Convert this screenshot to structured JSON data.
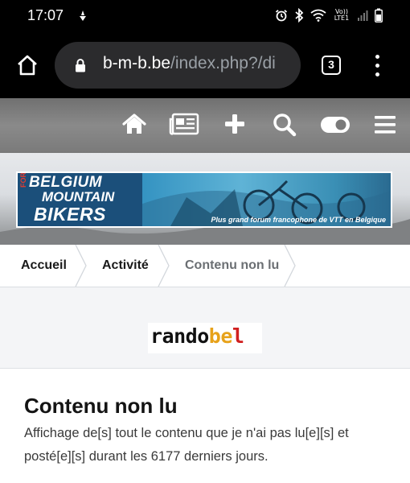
{
  "status_bar": {
    "time": "17:07",
    "volte_label": "Vo)) LTE1",
    "icons": [
      "alarm-icon",
      "bluetooth-icon",
      "wifi-icon",
      "signal-icon",
      "battery-icon"
    ]
  },
  "browser": {
    "url_domain": "b-m-b.be",
    "url_path": "/index.php?/di",
    "tab_count": "3",
    "icons": [
      "home-icon",
      "lock-icon",
      "overflow-menu-icon"
    ]
  },
  "forum_nav": {
    "icons": [
      "home-icon",
      "news-icon",
      "plus-icon",
      "search-icon",
      "theme-toggle-icon",
      "hamburger-menu-icon"
    ]
  },
  "banner": {
    "logo_forum": "FORUM",
    "logo_line1": "BELGIUM",
    "logo_line2": "MOUNTAIN",
    "logo_line3": "BIKERS",
    "tagline": "Plus grand forum francophone de VTT en Belgique"
  },
  "breadcrumb": {
    "items": [
      "Accueil",
      "Activité",
      "Contenu non lu"
    ]
  },
  "ad": {
    "logo_text": {
      "part1": "rando",
      "part2": "be",
      "part3": "l"
    }
  },
  "page": {
    "title": "Contenu non lu",
    "description": "Affichage de[s] tout le contenu que je n'ai pas lu[e][s] et posté[e][s] durant les 6177 derniers jours."
  },
  "colors": {
    "status_bg": "#000000",
    "urlbox_bg": "#2b2b2d",
    "forum_nav_bg": "#7a7a7a",
    "banner_blue": "#2f8fbf",
    "breadcrumb_border": "#d9dde2"
  }
}
